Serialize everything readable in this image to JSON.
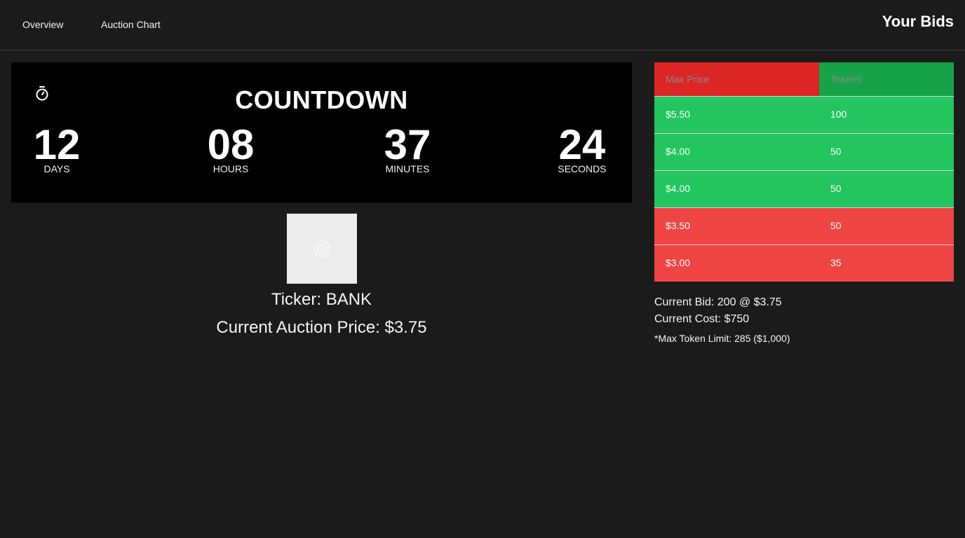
{
  "nav": {
    "tabs": [
      {
        "label": "Overview"
      },
      {
        "label": "Auction Chart"
      }
    ],
    "your_bids_title": "Your Bids"
  },
  "countdown": {
    "title": "COUNTDOWN",
    "icon": "stopwatch-icon",
    "units": [
      {
        "value": "12",
        "label": "DAYS"
      },
      {
        "value": "08",
        "label": "HOURS"
      },
      {
        "value": "37",
        "label": "MINUTES"
      },
      {
        "value": "24",
        "label": "SECONDS"
      }
    ]
  },
  "token": {
    "image_icon": "token-logo",
    "ticker": "Ticker: BANK",
    "auction_price": "Current Auction Price: $3.75"
  },
  "bids": {
    "headers": [
      "Max Price",
      "Tokens"
    ],
    "rows": [
      {
        "max_price": "$5.50",
        "tokens": "100",
        "status": "win"
      },
      {
        "max_price": "$4.00",
        "tokens": "50",
        "status": "win"
      },
      {
        "max_price": "$4.00",
        "tokens": "50",
        "status": "win"
      },
      {
        "max_price": "$3.50",
        "tokens": "50",
        "status": "lose"
      },
      {
        "max_price": "$3.00",
        "tokens": "35",
        "status": "lose"
      }
    ],
    "colors": {
      "win": "#22c55e",
      "lose": "#ef4444",
      "header_left": "#dc2626",
      "header_right": "#16a34a"
    }
  },
  "summary": {
    "current_bid": "Current Bid: 200 @ $3.75",
    "current_cost": "Current Cost: $750",
    "max_token_limit": "*Max Token Limit: 285 ($1,000)"
  }
}
